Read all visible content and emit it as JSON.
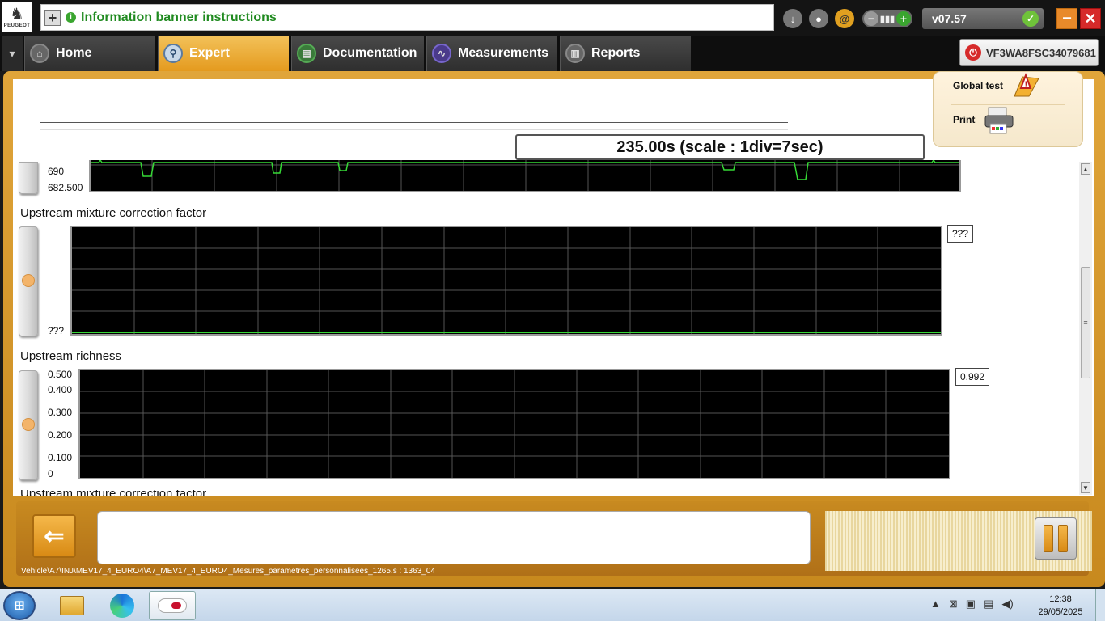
{
  "app": {
    "logo_text": "PEUGEOT",
    "banner_text": "Information banner instructions",
    "version": "v07.57"
  },
  "nav": {
    "tabs": [
      {
        "label": "Home",
        "active": false,
        "icon": "home-icon"
      },
      {
        "label": "Expert",
        "active": true,
        "icon": "magnifier-icon"
      },
      {
        "label": "Documentation",
        "active": false,
        "icon": "book-icon"
      },
      {
        "label": "Measurements",
        "active": false,
        "icon": "waveform-icon"
      },
      {
        "label": "Reports",
        "active": false,
        "icon": "report-icon"
      }
    ],
    "vin": "VF3WA8FSC34079681"
  },
  "side_menu": {
    "global_test": "Global test",
    "print": "Print"
  },
  "time_display": "235.00s (scale : 1div=7sec)",
  "charts": [
    {
      "title": "",
      "yticks": [
        "690",
        "682.500"
      ],
      "value": ""
    },
    {
      "title": "Upstream mixture correction factor",
      "yticks": [
        "???"
      ],
      "value": "???"
    },
    {
      "title": "Upstream richness",
      "yticks": [
        "0.500",
        "0.400",
        "0.300",
        "0.200",
        "0.100",
        "0"
      ],
      "value": "0.992"
    },
    {
      "title": "Upstream mixture correction factor"
    }
  ],
  "bottom": {
    "path": "Vehicle\\A7\\INJ\\MEV17_4_EURO4\\A7_MEV17_4_EURO4_Mesures_parametres_personnalisees_1265.s : 1363_04"
  },
  "taskbar": {
    "time": "12:38",
    "date": "29/05/2025"
  },
  "colors": {
    "accent": "#e49a1e",
    "trace": "#36d936",
    "plot_bg": "#000000",
    "grid": "#555555"
  }
}
